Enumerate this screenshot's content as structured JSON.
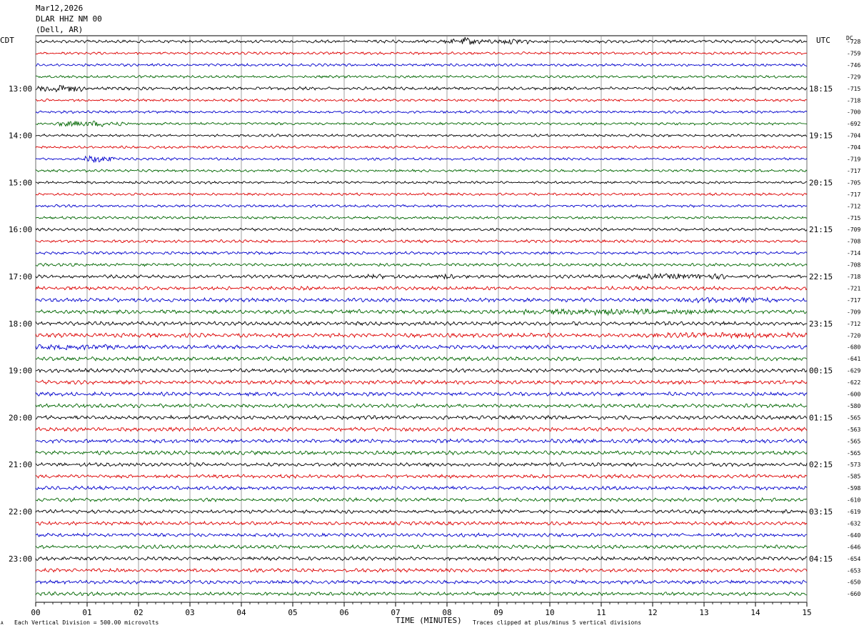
{
  "header": {
    "date": "Mar12,2026",
    "station": "DLAR HHZ NM 00",
    "location": "(Dell, AR)"
  },
  "axes": {
    "left_label": "CDT",
    "right_label": "UTC",
    "dc_label": "DC",
    "x_title": "TIME (MINUTES)"
  },
  "footer": {
    "scale_note": "Each Vertical Division =  500.00 microvolts",
    "clip_note": "Traces clipped at plus/minus 5 vertical divisions",
    "corner_mark": "A"
  },
  "colors": {
    "trace_cycle": [
      "#000000",
      "#dd0000",
      "#0000cc",
      "#006600"
    ],
    "grid": "#888888"
  },
  "chart_data": {
    "type": "line",
    "subtype": "helicorder",
    "x_ticks": [
      "00",
      "01",
      "02",
      "03",
      "04",
      "05",
      "06",
      "07",
      "08",
      "09",
      "10",
      "11",
      "12",
      "13",
      "14",
      "15"
    ],
    "xlim": [
      0,
      15
    ],
    "trace_count": 48,
    "traces_per_hour": 4,
    "left_hour_labels": [
      "13:00",
      "14:00",
      "15:00",
      "16:00",
      "17:00",
      "18:00",
      "19:00",
      "20:00",
      "21:00",
      "22:00",
      "23:00"
    ],
    "right_hour_labels": [
      "18:15",
      "19:15",
      "20:15",
      "21:15",
      "22:15",
      "23:15",
      "00:15",
      "01:15",
      "02:15",
      "03:15",
      "04:15"
    ],
    "hour_label_first_trace": 4,
    "dc_offsets": [
      "-728",
      "-759",
      "-746",
      "-729",
      "-715",
      "-718",
      "-700",
      "-692",
      "-704",
      "-704",
      "-719",
      "-717",
      "-705",
      "-717",
      "-712",
      "-715",
      "-709",
      "-708",
      "-714",
      "-708",
      "-718",
      "-721",
      "-717",
      "-709",
      "-712",
      "-720",
      "-680",
      "-641",
      "-629",
      "-622",
      "-600",
      "-580",
      "-565",
      "-563",
      "-565",
      "-565",
      "-573",
      "-585",
      "-598",
      "-610",
      "-619",
      "-632",
      "-640",
      "-646",
      "-654",
      "-653",
      "-650",
      "-660"
    ],
    "amplitude_levels": [
      1.2,
      1.0,
      1.0,
      1.0,
      1.2,
      1.0,
      1.0,
      1.0,
      1.0,
      1.0,
      1.0,
      1.0,
      1.0,
      1.0,
      1.0,
      1.0,
      1.1,
      1.1,
      1.1,
      1.2,
      1.3,
      1.4,
      1.5,
      1.5,
      1.5,
      1.6,
      1.5,
      1.5,
      1.5,
      1.5,
      1.5,
      1.5,
      1.5,
      1.5,
      1.5,
      1.5,
      1.4,
      1.4,
      1.4,
      1.4,
      1.4,
      1.4,
      1.4,
      1.4,
      1.4,
      1.4,
      1.4,
      1.4
    ],
    "events": [
      {
        "trace": 0,
        "start": 7.9,
        "end": 8.9,
        "gain": 2.5
      },
      {
        "trace": 0,
        "start": 8.3,
        "end": 8.5,
        "gain": 5
      },
      {
        "trace": 0,
        "start": 9.0,
        "end": 9.6,
        "gain": 3
      },
      {
        "trace": 4,
        "start": 0.0,
        "end": 0.9,
        "gain": 4
      },
      {
        "trace": 7,
        "start": 0.4,
        "end": 1.7,
        "gain": 3.5
      },
      {
        "trace": 10,
        "start": 0.9,
        "end": 1.5,
        "gain": 4.5
      },
      {
        "trace": 20,
        "start": 6.2,
        "end": 7.2,
        "gain": 1.6
      },
      {
        "trace": 20,
        "start": 7.8,
        "end": 8.2,
        "gain": 2.5
      },
      {
        "trace": 20,
        "start": 11.5,
        "end": 13.5,
        "gain": 2.5
      },
      {
        "trace": 22,
        "start": 12.5,
        "end": 14.5,
        "gain": 1.8
      },
      {
        "trace": 23,
        "start": 9.5,
        "end": 13.2,
        "gain": 2.2
      },
      {
        "trace": 23,
        "start": 5.8,
        "end": 6.3,
        "gain": 1.6
      },
      {
        "trace": 25,
        "start": 11.8,
        "end": 15.0,
        "gain": 1.6
      },
      {
        "trace": 26,
        "start": 0.0,
        "end": 1.6,
        "gain": 1.8
      }
    ]
  }
}
